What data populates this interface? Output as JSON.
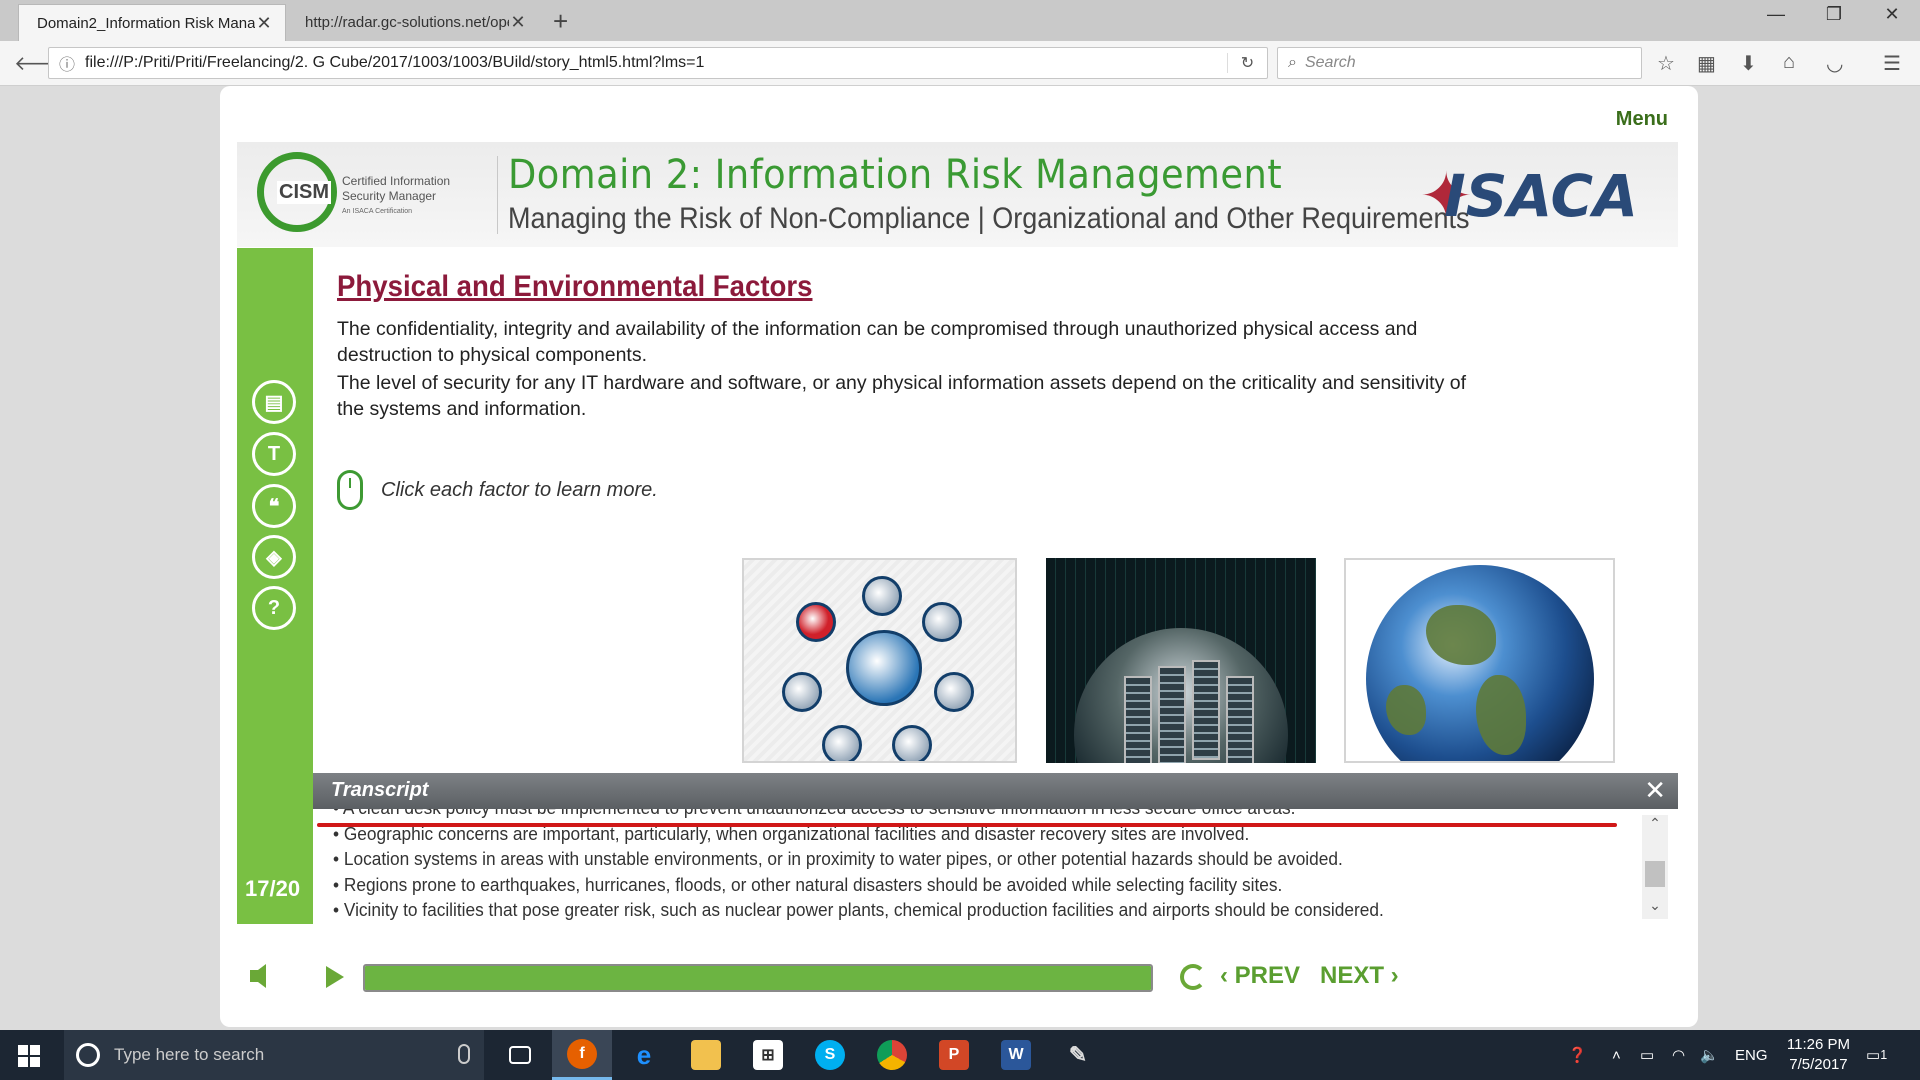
{
  "browser": {
    "tabs": [
      {
        "title": "Domain2_Information Risk Mana"
      },
      {
        "title": "http://radar.gc-solutions.net/ope"
      }
    ],
    "url": "file:///P:/Priti/Priti/Freelancing/2. G Cube/2017/1003/1003/BUild/story_html5.html?lms=1",
    "search_placeholder": "Search"
  },
  "course": {
    "menu_label": "Menu",
    "cism": {
      "badge": "CISM",
      "line1": "Certified Information",
      "line2": "Security Manager",
      "line3": "An ISACA Certification"
    },
    "domain_title": "Domain 2: Information Risk Management",
    "domain_subtitle": "Managing the Risk of Non-Compliance | Organizational and Other Requirements",
    "isaca_logo": "ISACA",
    "page_title": "Physical and Environmental Factors",
    "para1": "The confidentiality, integrity and availability of the information can be compromised through unauthorized physical access and destruction to physical components.",
    "para2": "The level of security for any IT hardware and software, or any physical information assets depend on the criticality and sensitivity of the systems and information.",
    "hint": "Click each factor to learn more.",
    "slide_counter": "17/20",
    "sidebar_icons": [
      "resources-icon",
      "glossary-icon",
      "quote-icon",
      "layers-icon",
      "help-icon"
    ],
    "sidebar_glyphs": [
      "▤",
      "T",
      "❝",
      "◈",
      "?"
    ]
  },
  "transcript": {
    "title": "Transcript",
    "lines": [
      "• A clean desk policy must be implemented to prevent unauthorized access to sensitive information in less secure office areas.",
      "• Geographic concerns are important, particularly, when organizational facilities and disaster recovery sites are involved.",
      "• Location systems in areas with unstable environments, or in proximity to water pipes, or other potential hazards should be avoided.",
      "• Regions prone to earthquakes, hurricanes, floods, or other natural disasters should be avoided while selecting facility sites.",
      "• Vicinity to facilities that pose greater risk, such as nuclear power plants, chemical production facilities and airports should be considered."
    ]
  },
  "controls": {
    "prev_label": "PREV",
    "next_label": "NEXT",
    "progress": 1.0
  },
  "taskbar": {
    "search_placeholder": "Type here to search",
    "language": "ENG",
    "time": "11:26 PM",
    "date": "7/5/2017",
    "notification_count": "1"
  },
  "colors": {
    "accent_green": "#79c043",
    "title_maroon": "#8c1a3b",
    "transcript_red": "#d01818"
  }
}
